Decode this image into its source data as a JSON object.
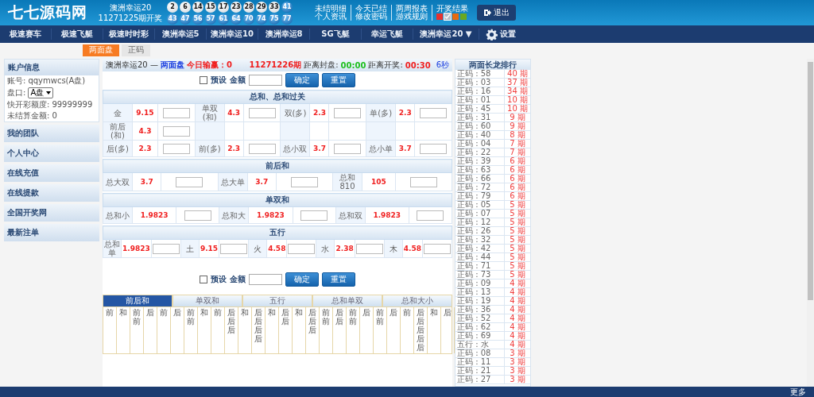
{
  "header": {
    "logo": "七七源码网",
    "draw_game": "澳洲幸运20",
    "draw_period": "11271225期开奖",
    "balls": [
      [
        {
          "n": "2",
          "kind": "white"
        },
        {
          "n": "6",
          "kind": "white"
        },
        {
          "n": "14",
          "kind": "white"
        },
        {
          "n": "15",
          "kind": "white"
        },
        {
          "n": "17",
          "kind": "white"
        },
        {
          "n": "23",
          "kind": "white"
        },
        {
          "n": "28",
          "kind": "white"
        },
        {
          "n": "29",
          "kind": "white"
        },
        {
          "n": "33",
          "kind": "white"
        },
        {
          "n": "41",
          "kind": "blue"
        }
      ],
      [
        {
          "n": "43",
          "kind": "blue"
        },
        {
          "n": "47",
          "kind": "blue"
        },
        {
          "n": "56",
          "kind": "blue"
        },
        {
          "n": "57",
          "kind": "blue"
        },
        {
          "n": "61",
          "kind": "blue"
        },
        {
          "n": "64",
          "kind": "blue"
        },
        {
          "n": "70",
          "kind": "blue"
        },
        {
          "n": "74",
          "kind": "blue"
        },
        {
          "n": "75",
          "kind": "blue"
        },
        {
          "n": "77",
          "kind": "blue"
        }
      ]
    ],
    "links_row1": [
      "未结明细",
      "今天已结",
      "两周报表",
      "开奖结果"
    ],
    "links_row2": [
      "个人资讯",
      "修改密码",
      "游戏规则"
    ],
    "themes": [
      {
        "color": "#e8322f",
        "selected": false
      },
      {
        "color": "#b8bcc8",
        "selected": true
      },
      {
        "color": "#e86a10",
        "selected": false
      },
      {
        "color": "#6aa820",
        "selected": false
      }
    ],
    "logout": "退出"
  },
  "nav": {
    "items": [
      "极速赛车",
      "极速飞艇",
      "极速时时彩",
      "澳洲幸运5",
      "澳洲幸运10",
      "澳洲幸运8",
      "SG飞艇",
      "幸运飞艇"
    ],
    "current": "澳洲幸运20 ▼",
    "settings": "设置"
  },
  "tabs": [
    {
      "label": "两面盘",
      "selected": true
    },
    {
      "label": "正码",
      "selected": false
    }
  ],
  "account": {
    "title": "账户信息",
    "rows": [
      {
        "label": "账号:",
        "value": "qqymwcs(A盘)"
      },
      {
        "label": "盘口:",
        "select": "A盘"
      },
      {
        "label": "快开彩额度:",
        "value": "99999999"
      },
      {
        "label": "未结算金额:",
        "value": "0"
      }
    ]
  },
  "sidebar": {
    "items": [
      "我的团队",
      "个人中心",
      "在线充值",
      "在线提款",
      "全国开奖网",
      "最新注单"
    ]
  },
  "game_bar": {
    "game": "澳洲幸运20 —",
    "mode": "两面盘",
    "today": "今日输赢：0",
    "period": "11271226期",
    "close_label": "距离封盘:",
    "close_time": "00:00",
    "draw_label": "距离开奖:",
    "draw_time": "00:30",
    "refresh": "6秒"
  },
  "bet_controls": [
    {
      "preset": "预设",
      "preset_checked": false,
      "amount": "金额",
      "confirm": "确定",
      "reset": "重置"
    },
    {
      "preset": "预设",
      "preset_checked": false,
      "amount": "金额",
      "confirm": "确定",
      "reset": "重置"
    }
  ],
  "sections": [
    {
      "title": "总和、总和过关",
      "rows": [
        [
          {
            "label": "金",
            "odds": "9.15"
          },
          {
            "label": "单双(和)",
            "odds": "4.3"
          },
          {
            "label": "双(多)",
            "odds": "2.3"
          },
          {
            "label": "单(多)",
            "odds": "2.3"
          }
        ],
        [
          {
            "label": "前后(和)",
            "odds": "4.3"
          }
        ],
        [
          {
            "label": "后(多)",
            "odds": "2.3"
          },
          {
            "label": "前(多)",
            "odds": "2.3"
          },
          {
            "label": "总小双",
            "odds": "3.7"
          },
          {
            "label": "总小单",
            "odds": "3.7"
          }
        ]
      ]
    },
    {
      "title": "前后和",
      "rows": [
        [
          {
            "label": "总大双",
            "odds": "3.7"
          },
          {
            "label": "总大单",
            "odds": "3.7"
          },
          {
            "label": "总和810",
            "odds": "105"
          }
        ]
      ]
    },
    {
      "title": "单双和",
      "rows": [
        [
          {
            "label": "总和小",
            "odds": "1.9823"
          },
          {
            "label": "总和大",
            "odds": "1.9823"
          },
          {
            "label": "总和双",
            "odds": "1.9823"
          }
        ]
      ]
    },
    {
      "title": "五行",
      "rows": [
        [
          {
            "label": "总和单",
            "odds": "1.9823"
          },
          {
            "label": "土",
            "odds": "9.15"
          },
          {
            "label": "火",
            "odds": "4.58"
          },
          {
            "label": "水",
            "odds": "2.38"
          },
          {
            "label": "木",
            "odds": "4.58"
          }
        ]
      ]
    }
  ],
  "result_tabs": [
    {
      "label": "前后和",
      "selected": true
    },
    {
      "label": "单双和",
      "selected": false
    },
    {
      "label": "五行",
      "selected": false
    },
    {
      "label": "总和单双",
      "selected": false
    },
    {
      "label": "总和大小",
      "selected": false
    }
  ],
  "result_columns": [
    "前",
    "和",
    "前前",
    "后",
    "前",
    "后",
    "前前",
    "和",
    "前",
    "后后后",
    "和",
    "后后后后",
    "和",
    "后后",
    "和",
    "后后后",
    "前前",
    "后后",
    "前前",
    "后",
    "前前",
    "后",
    "前",
    "后后后后后",
    "和",
    "后"
  ],
  "ranking": {
    "title": "两面长龙排行",
    "rows": [
      {
        "label": "正码 : 58",
        "count": "40 期"
      },
      {
        "label": "正码 : 03",
        "count": "37 期"
      },
      {
        "label": "正码 : 16",
        "count": "34 期"
      },
      {
        "label": "正码 : 01",
        "count": "10 期"
      },
      {
        "label": "正码 : 45",
        "count": "10 期"
      },
      {
        "label": "正码 : 31",
        "count": "9 期"
      },
      {
        "label": "正码 : 60",
        "count": "9 期"
      },
      {
        "label": "正码 : 40",
        "count": "8 期"
      },
      {
        "label": "正码 : 04",
        "count": "7 期"
      },
      {
        "label": "正码 : 22",
        "count": "7 期"
      },
      {
        "label": "正码 : 39",
        "count": "6 期"
      },
      {
        "label": "正码 : 63",
        "count": "6 期"
      },
      {
        "label": "正码 : 66",
        "count": "6 期"
      },
      {
        "label": "正码 : 72",
        "count": "6 期"
      },
      {
        "label": "正码 : 79",
        "count": "6 期"
      },
      {
        "label": "正码 : 05",
        "count": "5 期"
      },
      {
        "label": "正码 : 07",
        "count": "5 期"
      },
      {
        "label": "正码 : 12",
        "count": "5 期"
      },
      {
        "label": "正码 : 26",
        "count": "5 期"
      },
      {
        "label": "正码 : 32",
        "count": "5 期"
      },
      {
        "label": "正码 : 42",
        "count": "5 期"
      },
      {
        "label": "正码 : 44",
        "count": "5 期"
      },
      {
        "label": "正码 : 71",
        "count": "5 期"
      },
      {
        "label": "正码 : 73",
        "count": "5 期"
      },
      {
        "label": "正码 : 09",
        "count": "4 期"
      },
      {
        "label": "正码 : 13",
        "count": "4 期"
      },
      {
        "label": "正码 : 19",
        "count": "4 期"
      },
      {
        "label": "正码 : 36",
        "count": "4 期"
      },
      {
        "label": "正码 : 52",
        "count": "4 期"
      },
      {
        "label": "正码 : 62",
        "count": "4 期"
      },
      {
        "label": "正码 : 69",
        "count": "4 期"
      },
      {
        "label": "五行 : 水",
        "count": "4 期"
      },
      {
        "label": "正码 : 08",
        "count": "3 期"
      },
      {
        "label": "正码 : 11",
        "count": "3 期"
      },
      {
        "label": "正码 : 21",
        "count": "3 期"
      },
      {
        "label": "正码 : 27",
        "count": "3 期"
      }
    ]
  },
  "footer": {
    "more": "更多"
  }
}
